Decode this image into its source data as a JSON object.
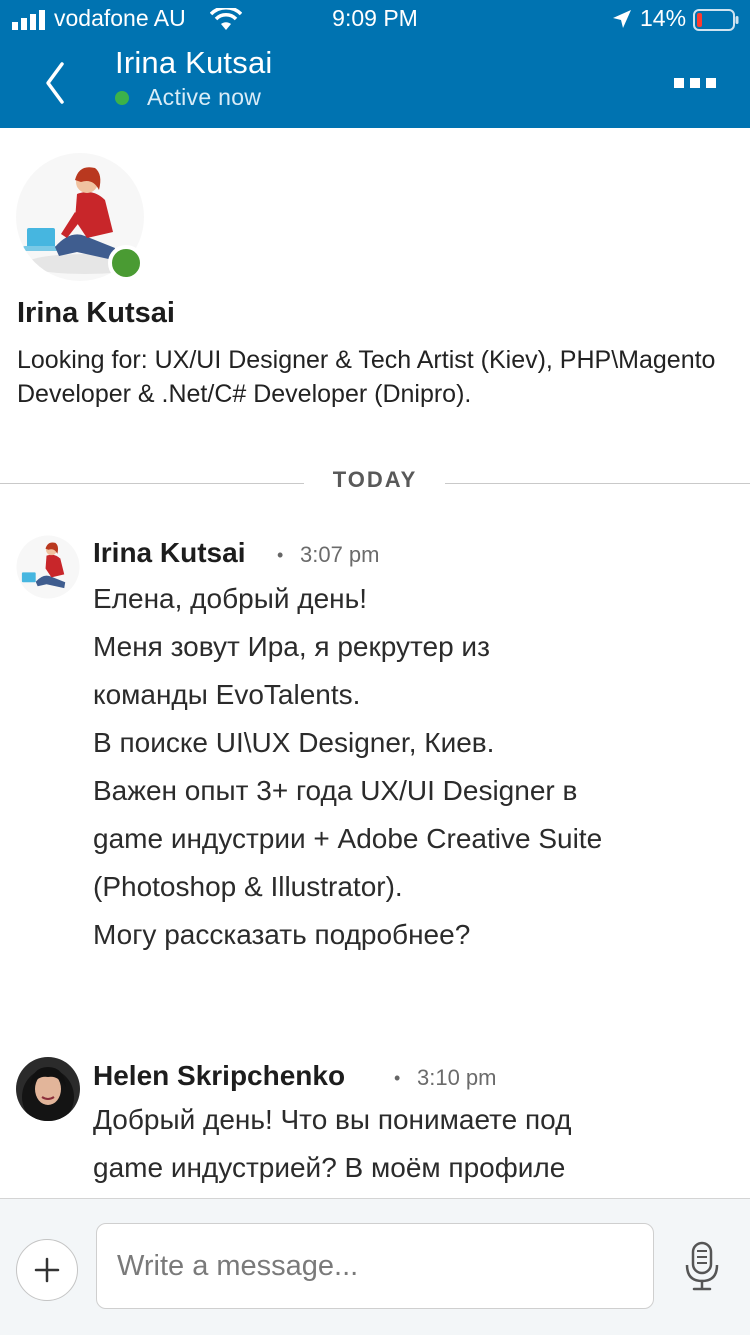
{
  "status_bar": {
    "carrier": "vodafone AU",
    "time": "9:09 PM",
    "battery": "14%"
  },
  "header": {
    "title": "Irina Kutsai",
    "status": "Active now",
    "icons": {
      "back": "chevron-left-icon",
      "more": "more-horizontal-icon"
    },
    "colors": {
      "bar": "#0073b1",
      "active": "#3cb24a"
    }
  },
  "profile": {
    "name": "Irina Kutsai",
    "headline": "Looking for: UX/UI Designer & Tech Artist (Kiev), PHP\\Magento Developer & .Net/C# Developer (Dnipro)."
  },
  "divider": {
    "label": "TODAY"
  },
  "messages": [
    {
      "sender": "Irina Kutsai",
      "time": "3:07 pm",
      "lines": [
        "Елена, добрый день!",
        "Меня зовут Ира, я рекрутер из",
        "команды EvoTalents.",
        "В поиске UI\\UX Designer, Киев.",
        "Важен опыт 3+ года UX/UI Designer в",
        "game индустрии + Adobe Creative Suite",
        "(Photoshop & Illustrator).",
        "Могу рассказать подробнее?"
      ]
    },
    {
      "sender": "Helen Skripchenko",
      "time": "3:10 pm",
      "lines": [
        "Добрый день! Что вы понимаете под",
        "game индустрией? В моём профиле"
      ]
    }
  ],
  "composer": {
    "placeholder": "Write a message...",
    "icons": {
      "add": "plus-icon",
      "mic": "microphone-icon"
    }
  }
}
